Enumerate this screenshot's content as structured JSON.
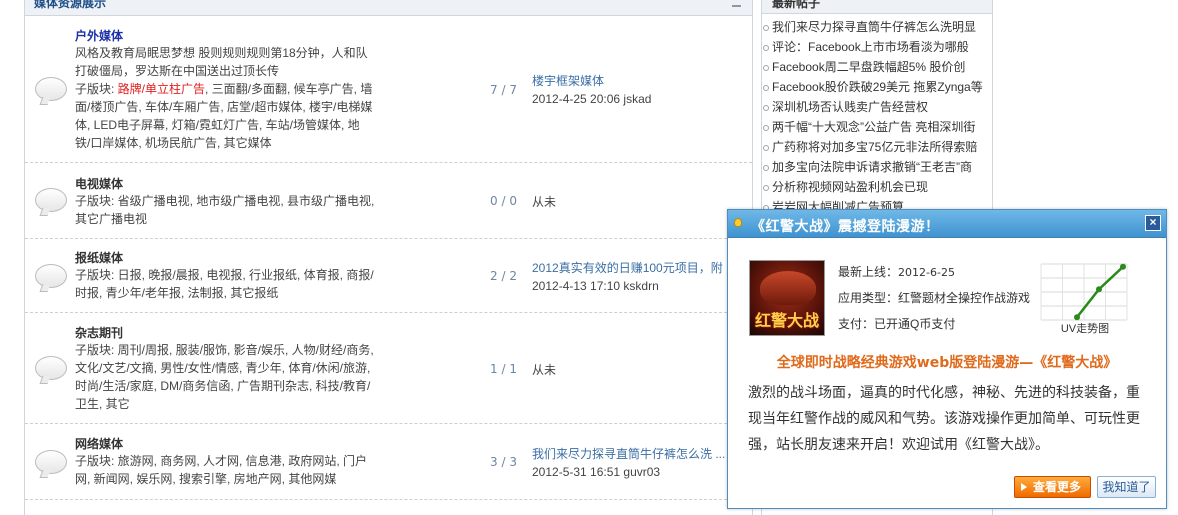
{
  "left": {
    "title": "媒体资源展示",
    "forums": [
      {
        "name": "户外媒体",
        "desc": "风格及教育局眠思梦想 股则规则规则第18分钟，人和队打破僵局，罗达斯在中国送出过顶长传",
        "subs_label": "子版块: ",
        "subs_highlight": "路牌/单立柱广告",
        "subs": ", 三面翻/多面翻, 候车亭广告, 墙面/楼顶广告, 车体/车厢广告, 店堂/超市媒体, 楼宇/电梯媒体, LED电子屏幕, 灯箱/霓虹灯广告, 车站/场管媒体, 地铁/口岸媒体, 机场民航广告, 其它媒体",
        "count": "7 / 7",
        "last_title": "楼宇框架媒体",
        "last_meta": "2012-4-25 20:06 jskad"
      },
      {
        "name": "电视媒体",
        "desc": "",
        "subs_label": "子版块: ",
        "subs_highlight": "",
        "subs": "省级广播电视, 地市级广播电视, 县市级广播电视, 其它广播电视",
        "count": "0 / 0",
        "last_title": "",
        "last_meta": "从未"
      },
      {
        "name": "报纸媒体",
        "desc": "",
        "subs_label": "子版块: ",
        "subs_highlight": "",
        "subs": "日报, 晚报/晨报, 电视报, 行业报纸, 体育报, 商报/时报, 青少年/老年报, 法制报, 其它报纸",
        "count": "2 / 2",
        "last_title": "2012真实有效的日赚100元项目，附",
        "last_meta": "2012-4-13 17:10 kskdrn"
      },
      {
        "name": "杂志期刊",
        "desc": "",
        "subs_label": "子版块: ",
        "subs_highlight": "",
        "subs": "周刊/周报, 服装/服饰, 影音/娱乐, 人物/财经/商务, 文化/文艺/文摘, 男性/女性/情感, 青少年, 体育/休闲/旅游, 时尚/生活/家庭, DM/商务信函, 广告期刊杂志, 科技/教育/卫生, 其它",
        "count": "1 / 1",
        "last_title": "",
        "last_meta": "从未"
      },
      {
        "name": "网络媒体",
        "desc": "",
        "subs_label": "子版块: ",
        "subs_highlight": "",
        "subs": "旅游网, 商务网, 人才网, 信息港, 政府网站, 门户网, 新闻网, 娱乐网, 搜索引擎, 房地产网, 其他网媒",
        "count": "3 / 3",
        "last_title": "我们来尽力探寻直筒牛仔裤怎么洗 ...",
        "last_meta": "2012-5-31 16:51 guvr03"
      }
    ]
  },
  "right": {
    "title": "最新帖子",
    "posts": [
      "我们来尽力探寻直筒牛仔裤怎么洗明显",
      "评论：Facebook上市市场看淡为哪般",
      "Facebook周二早盘跌幅超5% 股价创",
      "Facebook股价跌破29美元 拖累Zynga等",
      "深圳机场否认贱卖广告经营权",
      "两千幅“十大观念”公益广告 亮相深圳街",
      "广药称将对加多宝75亿元非法所得索赔",
      "加多宝向法院申诉请求撤销“王老吉”商",
      "分析称视频网站盈利机会已现",
      "岩岩网大幅削减广告预算"
    ]
  },
  "popup": {
    "title": "《红警大战》震撼登陆漫游！",
    "close": "×",
    "thumb_text": "红警大战",
    "meta": [
      {
        "label": "最新上线：",
        "value": "2012-6-25"
      },
      {
        "label": "应用类型：",
        "value": "红警题材全操控作战游戏"
      },
      {
        "label": "支付：",
        "value": "已开通Q币支付"
      }
    ],
    "trend_label": "UV走势图",
    "trend": [
      0.05,
      0.55,
      0.95
    ],
    "promo_title": "全球即时战略经典游戏web版登陆漫游—《红警大战》",
    "promo_body": "激烈的战斗场面，逼真的时代化感，神秘、先进的科技装备，重现当年红警作战的威风和气势。该游戏操作更加简单、可玩性更强，站长朋友速来开启！欢迎试用《红警大战》。",
    "btn_more": "查看更多",
    "btn_known": "我知道了",
    "colors": {
      "accent": "#e06a1b",
      "header": "#3f93d0",
      "trend": "#2a8a1a"
    }
  }
}
